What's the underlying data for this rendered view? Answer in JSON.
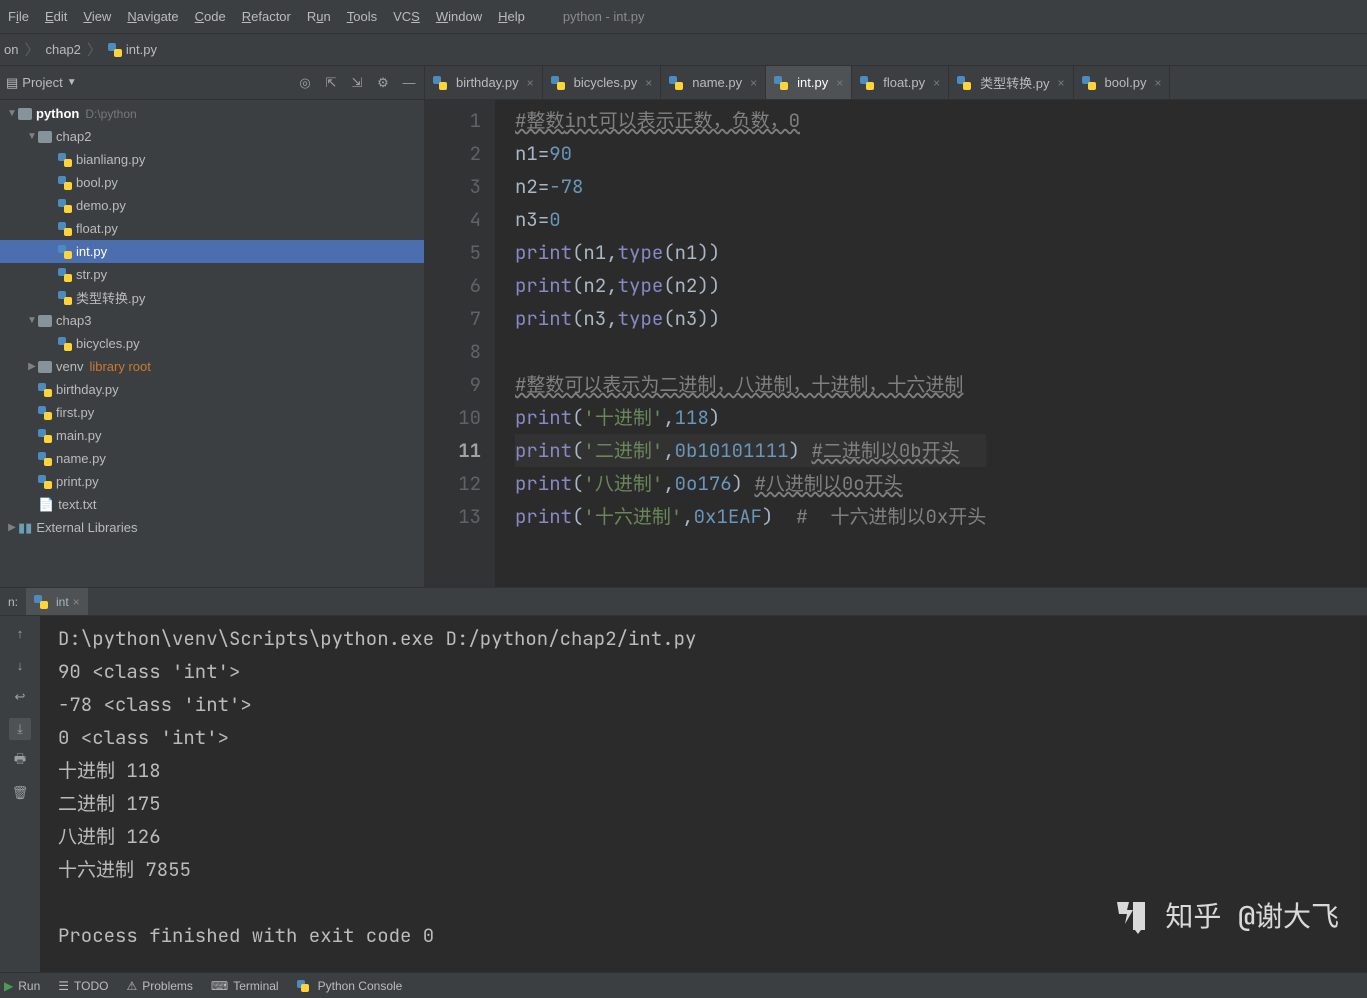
{
  "window": {
    "title": "python - int.py"
  },
  "menu": [
    "File",
    "Edit",
    "View",
    "Navigate",
    "Code",
    "Refactor",
    "Run",
    "Tools",
    "VCS",
    "Window",
    "Help"
  ],
  "breadcrumb": [
    "on",
    "chap2",
    "int.py"
  ],
  "sidebar": {
    "title": "Project",
    "root": {
      "name": "python",
      "path": "D:\\python"
    },
    "tree": [
      {
        "depth": 0,
        "type": "project",
        "label": "python",
        "hint": "D:\\python"
      },
      {
        "depth": 1,
        "type": "folder",
        "label": "chap2",
        "open": true
      },
      {
        "depth": 2,
        "type": "py",
        "label": "bianliang.py"
      },
      {
        "depth": 2,
        "type": "py",
        "label": "bool.py"
      },
      {
        "depth": 2,
        "type": "py",
        "label": "demo.py"
      },
      {
        "depth": 2,
        "type": "py",
        "label": "float.py"
      },
      {
        "depth": 2,
        "type": "py",
        "label": "int.py",
        "selected": true
      },
      {
        "depth": 2,
        "type": "py",
        "label": "str.py"
      },
      {
        "depth": 2,
        "type": "py",
        "label": "类型转换.py"
      },
      {
        "depth": 1,
        "type": "folder",
        "label": "chap3",
        "open": true
      },
      {
        "depth": 2,
        "type": "py",
        "label": "bicycles.py"
      },
      {
        "depth": 1,
        "type": "folder",
        "label": "venv",
        "libroot": "library root",
        "closed": true
      },
      {
        "depth": 1,
        "type": "py",
        "label": "birthday.py"
      },
      {
        "depth": 1,
        "type": "py",
        "label": "first.py"
      },
      {
        "depth": 1,
        "type": "py",
        "label": "main.py"
      },
      {
        "depth": 1,
        "type": "py",
        "label": "name.py"
      },
      {
        "depth": 1,
        "type": "py",
        "label": "print.py"
      },
      {
        "depth": 1,
        "type": "txt",
        "label": "text.txt"
      },
      {
        "depth": 0,
        "type": "lib",
        "label": "External Libraries"
      }
    ]
  },
  "tabs": [
    {
      "label": "birthday.py"
    },
    {
      "label": "bicycles.py"
    },
    {
      "label": "name.py"
    },
    {
      "label": "int.py",
      "active": true
    },
    {
      "label": "float.py"
    },
    {
      "label": "类型转换.py"
    },
    {
      "label": "bool.py"
    }
  ],
  "code": {
    "lines": [
      [
        {
          "t": "#整数",
          "c": "cmt wavy"
        },
        {
          "t": "int",
          "c": "cmt wavy"
        },
        {
          "t": "可以表示正数，负数，0",
          "c": "cmt wavy"
        }
      ],
      [
        {
          "t": "n1",
          "c": "ident"
        },
        {
          "t": "=",
          "c": "op"
        },
        {
          "t": "90",
          "c": "num"
        }
      ],
      [
        {
          "t": "n2",
          "c": "ident"
        },
        {
          "t": "=",
          "c": "op"
        },
        {
          "t": "-78",
          "c": "num"
        }
      ],
      [
        {
          "t": "n3",
          "c": "ident"
        },
        {
          "t": "=",
          "c": "op"
        },
        {
          "t": "0",
          "c": "num"
        }
      ],
      [
        {
          "t": "print",
          "c": "builtin"
        },
        {
          "t": "(",
          "c": "op"
        },
        {
          "t": "n1",
          "c": "ident"
        },
        {
          "t": ",",
          "c": "op"
        },
        {
          "t": "type",
          "c": "builtin"
        },
        {
          "t": "(",
          "c": "op"
        },
        {
          "t": "n1",
          "c": "ident"
        },
        {
          "t": "))",
          "c": "op"
        }
      ],
      [
        {
          "t": "print",
          "c": "builtin"
        },
        {
          "t": "(",
          "c": "op"
        },
        {
          "t": "n2",
          "c": "ident"
        },
        {
          "t": ",",
          "c": "op"
        },
        {
          "t": "type",
          "c": "builtin"
        },
        {
          "t": "(",
          "c": "op"
        },
        {
          "t": "n2",
          "c": "ident"
        },
        {
          "t": "))",
          "c": "op"
        }
      ],
      [
        {
          "t": "print",
          "c": "builtin"
        },
        {
          "t": "(",
          "c": "op"
        },
        {
          "t": "n3",
          "c": "ident"
        },
        {
          "t": ",",
          "c": "op"
        },
        {
          "t": "type",
          "c": "builtin"
        },
        {
          "t": "(",
          "c": "op"
        },
        {
          "t": "n3",
          "c": "ident"
        },
        {
          "t": "))",
          "c": "op"
        }
      ],
      [],
      [
        {
          "t": "#整数可以表示为二进制，八进制，十进制，十六进制",
          "c": "cmt wavy"
        }
      ],
      [
        {
          "t": "print",
          "c": "builtin"
        },
        {
          "t": "(",
          "c": "op"
        },
        {
          "t": "'十进制'",
          "c": "str"
        },
        {
          "t": ",",
          "c": "op"
        },
        {
          "t": "118",
          "c": "num"
        },
        {
          "t": ")",
          "c": "op"
        }
      ],
      [
        {
          "t": "print",
          "c": "builtin"
        },
        {
          "t": "(",
          "c": "op"
        },
        {
          "t": "'二进制'",
          "c": "str"
        },
        {
          "t": ",",
          "c": "op"
        },
        {
          "t": "0b10101111",
          "c": "num"
        },
        {
          "t": ") ",
          "c": "op"
        },
        {
          "t": "#二进制以0b开头",
          "c": "cmt wavy"
        }
      ],
      [
        {
          "t": "print",
          "c": "builtin"
        },
        {
          "t": "(",
          "c": "op"
        },
        {
          "t": "'八进制'",
          "c": "str"
        },
        {
          "t": ",",
          "c": "op"
        },
        {
          "t": "0o176",
          "c": "num"
        },
        {
          "t": ") ",
          "c": "op"
        },
        {
          "t": "#八进制以0o开头",
          "c": "cmt wavy"
        }
      ],
      [
        {
          "t": "print",
          "c": "builtin"
        },
        {
          "t": "(",
          "c": "op"
        },
        {
          "t": "'十六进制'",
          "c": "str"
        },
        {
          "t": ",",
          "c": "op"
        },
        {
          "t": "0x1EAF",
          "c": "num"
        },
        {
          "t": ")  ",
          "c": "op"
        },
        {
          "t": "#  十六进制以0x开头",
          "c": "cmt"
        }
      ]
    ],
    "current_line": 11
  },
  "run": {
    "label": "n:",
    "tab": "int",
    "output": [
      "D:\\python\\venv\\Scripts\\python.exe D:/python/chap2/int.py",
      "90 <class 'int'>",
      "-78 <class 'int'>",
      "0 <class 'int'>",
      "十进制 118",
      "二进制 175",
      "八进制 126",
      "十六进制 7855",
      "",
      "Process finished with exit code 0"
    ]
  },
  "watermark": "知乎 @谢大飞",
  "statusbar": [
    "Run",
    "TODO",
    "Problems",
    "Terminal",
    "Python Console"
  ]
}
